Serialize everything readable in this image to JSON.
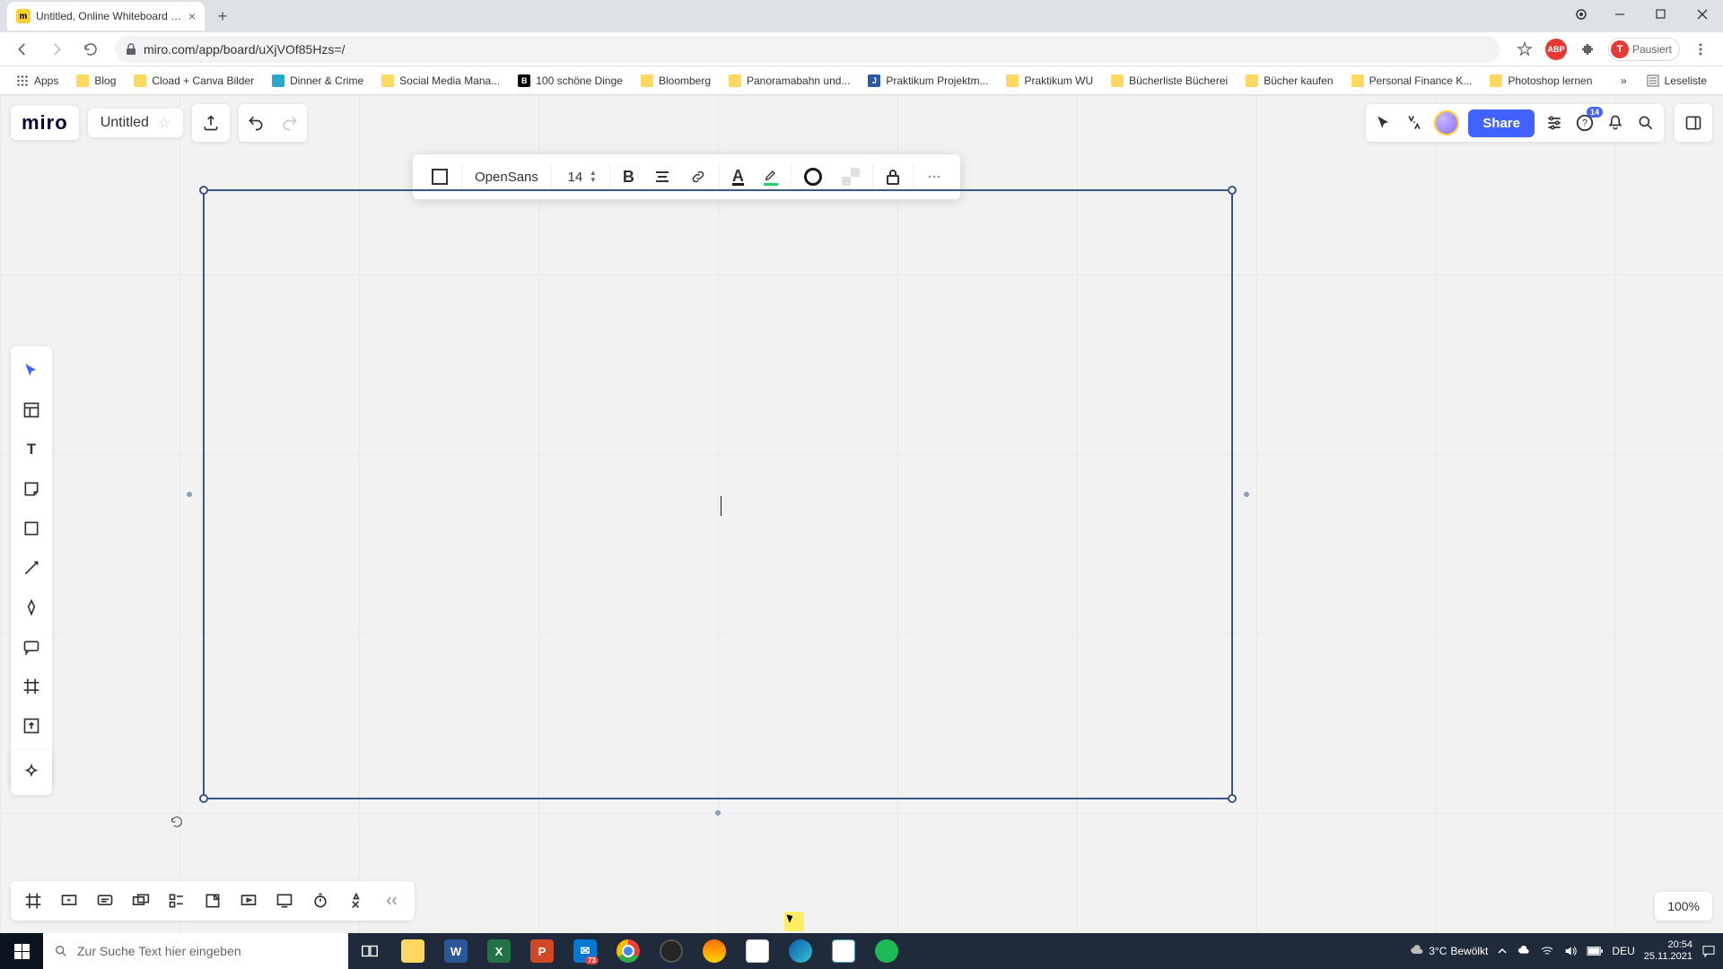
{
  "browser": {
    "tab_title": "Untitled, Online Whiteboard for",
    "url": "miro.com/app/board/uXjVOf85Hzs=/",
    "profile_label": "Pausiert",
    "bookmarks": [
      "Apps",
      "Blog",
      "Cload + Canva Bilder",
      "Dinner & Crime",
      "Social Media Mana...",
      "100 schöne Dinge",
      "Bloomberg",
      "Panoramabahn und...",
      "Praktikum Projektm...",
      "Praktikum WU",
      "Bücherliste Bücherei",
      "Bücher kaufen",
      "Personal Finance K...",
      "Photoshop lernen"
    ],
    "bookmarks_overflow": "»",
    "reading_list": "Leseliste"
  },
  "app": {
    "logo": "miro",
    "board_title": "Untitled",
    "share_label": "Share",
    "notification_badge": "14",
    "font_name": "OpenSans",
    "font_size": "14",
    "zoom": "100%"
  },
  "taskbar": {
    "search_placeholder": "Zur Suche Text hier eingeben",
    "weather_temp": "3°C",
    "weather_desc": "Bewölkt",
    "lang": "DEU",
    "time": "20:54",
    "date": "25.11.2021"
  }
}
